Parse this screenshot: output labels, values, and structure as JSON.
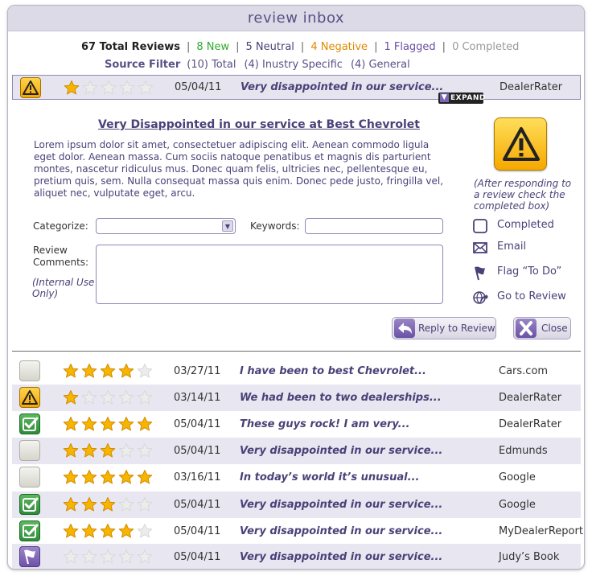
{
  "title": "review inbox",
  "summary": {
    "total": "67 Total Reviews",
    "new": "8 New",
    "neutral": "5 Neutral",
    "negative": "4 Negative",
    "flagged": "1 Flagged",
    "completed": "0 Completed",
    "separator": "|"
  },
  "source_filter": {
    "label": "Source Filter",
    "options": [
      "(10) Total",
      "(4) Inustry Specific",
      "(4) General"
    ]
  },
  "selected_review": {
    "status": "warning",
    "rating": 1,
    "date": "05/04/11",
    "excerpt": "Very disappointed in our service...",
    "source": "DealerRater",
    "expand_label": "EXPAND"
  },
  "detail": {
    "title": "Very Disappointed in our service at Best Chevrolet",
    "body": "Lorem ipsum dolor sit amet, consectetuer adipiscing elit. Aenean commodo ligula eget dolor. Aenean massa. Cum sociis natoque penatibus et magnis dis parturient montes, nascetur ridiculus mus. Donec quam felis, ultricies nec, pellentesque eu, pretium quis, sem. Nulla consequat massa quis enim. Donec pede justo, fringilla vel, aliquet nec, vulputate eget, arcu.",
    "help_text": "(After responding to a review check the completed box)",
    "categorize_label": "Categorize:",
    "categorize_value": "",
    "keywords_label": "Keywords:",
    "keywords_value": "",
    "comments_label_1": "Review",
    "comments_label_2": "Comments:",
    "comments_value": "",
    "internal_note": "(Internal Use Only)",
    "actions": {
      "completed": "Completed",
      "email": "Email",
      "flag": "Flag “To Do”",
      "goto": "Go to Review"
    },
    "reply_button": "Reply to Review",
    "close_button": "Close"
  },
  "reviews": [
    {
      "status": "none",
      "rating": 4,
      "date": "03/27/11",
      "excerpt": "I have been to best Chevrolet...",
      "source": "Cars.com"
    },
    {
      "status": "warning",
      "rating": 1,
      "date": "03/14/11",
      "excerpt": "We had been to two dealerships...",
      "source": "DealerRater"
    },
    {
      "status": "completed",
      "rating": 5,
      "date": "05/04/11",
      "excerpt": "These guys rock! I am very...",
      "source": "DealerRater"
    },
    {
      "status": "none",
      "rating": 3,
      "date": "05/04/11",
      "excerpt": "Very disappointed in our service...",
      "source": "Edmunds"
    },
    {
      "status": "none",
      "rating": 5,
      "date": "03/16/11",
      "excerpt": "In today’s world it’s unusual...",
      "source": "Google"
    },
    {
      "status": "completed",
      "rating": 3,
      "date": "05/04/11",
      "excerpt": "Very disappointed in our service...",
      "source": "Google"
    },
    {
      "status": "completed",
      "rating": 4,
      "date": "05/04/11",
      "excerpt": "Very disappointed in our service...",
      "source": "MyDealerReport"
    },
    {
      "status": "flagged",
      "rating": 0,
      "date": "05/04/11",
      "excerpt": "Very disappointed in our service...",
      "source": "Judy’s Book"
    }
  ],
  "colors": {
    "accent": "#4b4178",
    "star_filled": "#f7b500",
    "star_empty": "#ececec",
    "new": "#2faa2f",
    "negative": "#e08a00",
    "flagged": "#6a4fa3"
  }
}
